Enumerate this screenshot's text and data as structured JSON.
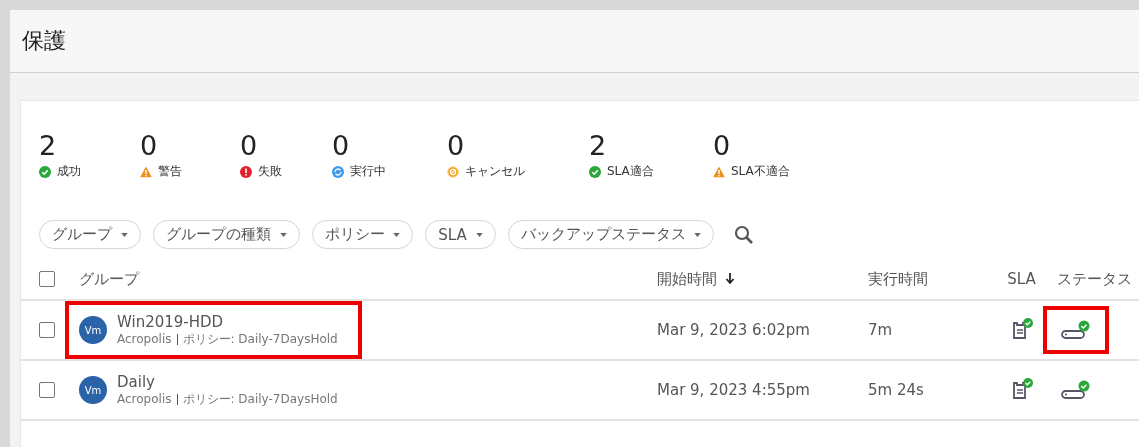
{
  "title": "保護",
  "stats": [
    {
      "count": "2",
      "label": "成功",
      "kind": "success"
    },
    {
      "count": "0",
      "label": "警告",
      "kind": "warning"
    },
    {
      "count": "0",
      "label": "失敗",
      "kind": "error"
    },
    {
      "count": "0",
      "label": "実行中",
      "kind": "running"
    },
    {
      "count": "0",
      "label": "キャンセル",
      "kind": "cancel"
    },
    {
      "count": "2",
      "label": "SLA適合",
      "kind": "success"
    },
    {
      "count": "0",
      "label": "SLA不適合",
      "kind": "warning"
    }
  ],
  "filters": [
    "グループ",
    "グループの種類",
    "ポリシー",
    "SLA",
    "バックアップステータス"
  ],
  "table": {
    "columns": [
      "グループ",
      "開始時間",
      "実行時間",
      "SLA",
      "ステータス"
    ],
    "select_all_checked": false,
    "rows": [
      {
        "checked": false,
        "avatar": "Vm",
        "name": "Win2019-HDD",
        "source": "Acropolis",
        "policy": "ポリシー: Daily-7DaysHold",
        "start": "Mar 9, 2023 6:02pm",
        "duration": "7m",
        "highlight_group": true,
        "highlight_status": true
      },
      {
        "checked": false,
        "avatar": "Vm",
        "name": "Daily",
        "source": "Acropolis",
        "policy": "ポリシー: Daily-7DaysHold",
        "start": "Mar 9, 2023 4:55pm",
        "duration": "5m 24s",
        "highlight_group": false,
        "highlight_status": false
      }
    ]
  }
}
